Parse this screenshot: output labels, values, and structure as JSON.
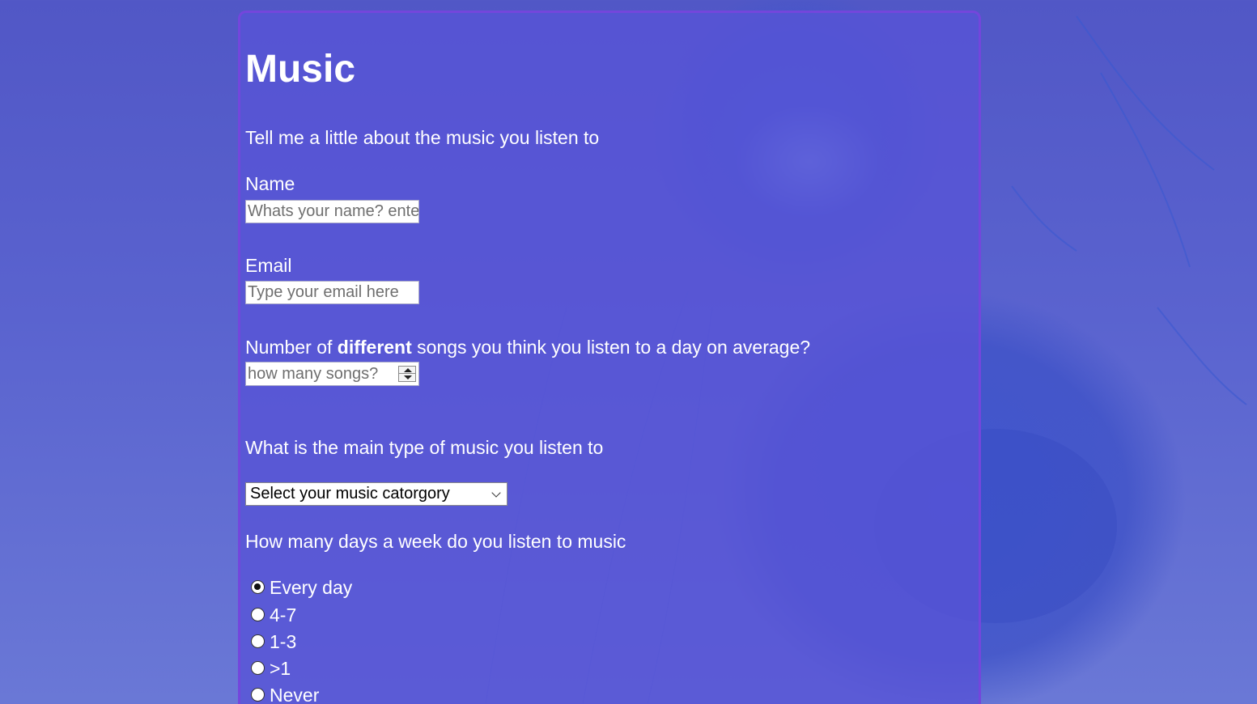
{
  "page": {
    "title": "Music",
    "intro": "Tell me a little about the music you listen to"
  },
  "name_field": {
    "label": "Name",
    "placeholder": "Whats your name? ente"
  },
  "email_field": {
    "label": "Email",
    "placeholder": "Type your email here"
  },
  "songs_field": {
    "label_before": "Number of ",
    "label_emphasis": "different",
    "label_after": " songs you think you listen to a day on average?",
    "placeholder": "how many songs?"
  },
  "genre_field": {
    "label": "What is the main type of music you listen to",
    "selected": "Select your music catorgory"
  },
  "days_field": {
    "label": "How many days a week do you listen to music",
    "options": [
      {
        "label": "Every day",
        "checked": true
      },
      {
        "label": "4-7",
        "checked": false
      },
      {
        "label": "1-3",
        "checked": false
      },
      {
        "label": ">1",
        "checked": false
      },
      {
        "label": "Never",
        "checked": false
      }
    ]
  },
  "icons": {
    "number_spinner": "spinner-arrows-icon",
    "select_dropdown": "chevron-down-icon"
  },
  "colors": {
    "background": "#5157c6",
    "panel": "#5854d6",
    "panel_border": "#7646dc",
    "text": "#ffffff"
  }
}
